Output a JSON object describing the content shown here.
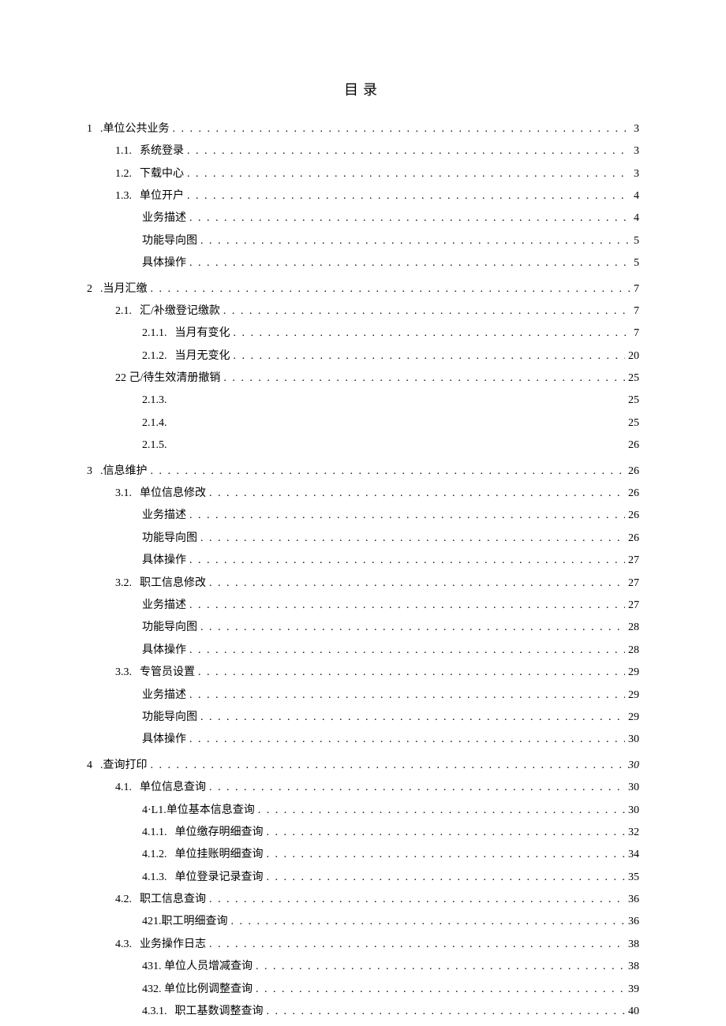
{
  "title": "目录",
  "entries": [
    {
      "indent": 0,
      "num": "1",
      "label": ".单位公共业务",
      "page": "3",
      "dots": true,
      "gap": false
    },
    {
      "indent": 1,
      "num": "1.1.",
      "label": "系统登录",
      "page": "3",
      "dots": true,
      "gap": false
    },
    {
      "indent": 1,
      "num": "1.2.",
      "label": "下载中心",
      "page": "3",
      "dots": true,
      "gap": false
    },
    {
      "indent": 1,
      "num": "1.3.",
      "label": "单位开户",
      "page": "4",
      "dots": true,
      "gap": false
    },
    {
      "indent": 2,
      "num": "",
      "label": "业务描述",
      "page": "4",
      "dots": true,
      "gap": false
    },
    {
      "indent": 2,
      "num": "",
      "label": "功能导向图",
      "page": "5",
      "dots": true,
      "gap": false
    },
    {
      "indent": 2,
      "num": "",
      "label": "具体操作",
      "page": "5",
      "dots": true,
      "gap": false
    },
    {
      "indent": 0,
      "num": "2",
      "label": ".当月汇缴",
      "page": "7",
      "dots": true,
      "gap": true
    },
    {
      "indent": 1,
      "num": "2.1.",
      "label": "汇/补缴登记缴款",
      "page": "7",
      "dots": true,
      "gap": false
    },
    {
      "indent": 2,
      "num": "2.1.1.",
      "label": "当月有变化",
      "page": "7",
      "dots": true,
      "gap": false
    },
    {
      "indent": 2,
      "num": "2.1.2.",
      "label": "当月无变化",
      "page": "20",
      "dots": true,
      "gap": false
    },
    {
      "indent": 1,
      "num": "",
      "label": "22 己/待生效清册撤销",
      "page": "25",
      "dots": true,
      "gap": false
    },
    {
      "indent": 2,
      "num": "2.1.3.",
      "label": "",
      "page": "25",
      "dots": false,
      "gap": false
    },
    {
      "indent": 2,
      "num": "2.1.4.",
      "label": "",
      "page": "25",
      "dots": false,
      "gap": false
    },
    {
      "indent": 2,
      "num": "2.1.5.",
      "label": "",
      "page": "26",
      "dots": false,
      "gap": false
    },
    {
      "indent": 0,
      "num": "3",
      "label": ".信息维护",
      "page": "26",
      "dots": true,
      "gap": true
    },
    {
      "indent": 1,
      "num": "3.1.",
      "label": "单位信息修改",
      "page": "26",
      "dots": true,
      "gap": false
    },
    {
      "indent": 2,
      "num": "",
      "label": "业务描述",
      "page": "26",
      "dots": true,
      "gap": false
    },
    {
      "indent": 2,
      "num": "",
      "label": "功能导向图",
      "page": "26",
      "dots": true,
      "gap": false
    },
    {
      "indent": 2,
      "num": "",
      "label": "具体操作",
      "page": "27",
      "dots": true,
      "gap": false
    },
    {
      "indent": 1,
      "num": "3.2.",
      "label": "职工信息修改",
      "page": "27",
      "dots": true,
      "gap": false
    },
    {
      "indent": 2,
      "num": "",
      "label": "业务描述",
      "page": "27",
      "dots": true,
      "gap": false
    },
    {
      "indent": 2,
      "num": "",
      "label": "功能导向图",
      "page": "28",
      "dots": true,
      "gap": false
    },
    {
      "indent": 2,
      "num": "",
      "label": "具体操作",
      "page": "28",
      "dots": true,
      "gap": false
    },
    {
      "indent": 1,
      "num": "3.3.",
      "label": "专管员设置",
      "page": "29",
      "dots": true,
      "gap": false
    },
    {
      "indent": 2,
      "num": "",
      "label": "业务描述",
      "page": "29",
      "dots": true,
      "gap": false
    },
    {
      "indent": 2,
      "num": "",
      "label": "功能导向图",
      "page": "29",
      "dots": true,
      "gap": false
    },
    {
      "indent": 2,
      "num": "",
      "label": "具体操作",
      "page": "30",
      "dots": true,
      "gap": false
    },
    {
      "indent": 0,
      "num": "4",
      "label": ".查询打印",
      "page": "30",
      "dots": true,
      "gap": true,
      "italicPage": true
    },
    {
      "indent": 1,
      "num": "4.1.",
      "label": "单位信息查询",
      "page": "30",
      "dots": true,
      "gap": false
    },
    {
      "indent": 2,
      "num": "",
      "label": "4·L1.单位基本信息查询",
      "page": "30",
      "dots": true,
      "gap": false
    },
    {
      "indent": 2,
      "num": "4.1.1.",
      "label": "单位缴存明细查询",
      "page": "32",
      "dots": true,
      "gap": false
    },
    {
      "indent": 2,
      "num": "4.1.2.",
      "label": "单位挂账明细查询",
      "page": "34",
      "dots": true,
      "gap": false
    },
    {
      "indent": 2,
      "num": "4.1.3.",
      "label": "单位登录记录查询",
      "page": "35",
      "dots": true,
      "gap": false
    },
    {
      "indent": 1,
      "num": "4.2.",
      "label": "职工信息查询",
      "page": "36",
      "dots": true,
      "gap": false
    },
    {
      "indent": 2,
      "num": "",
      "label": "421.职工明细查询",
      "page": "36",
      "dots": true,
      "gap": false
    },
    {
      "indent": 1,
      "num": "4.3.",
      "label": "业务操作日志",
      "page": "38",
      "dots": true,
      "gap": false
    },
    {
      "indent": 2,
      "num": "",
      "label": "431. 单位人员增减查询",
      "page": "38",
      "dots": true,
      "gap": false
    },
    {
      "indent": 2,
      "num": "",
      "label": "432. 单位比例调整查询",
      "page": "39",
      "dots": true,
      "gap": false
    },
    {
      "indent": 2,
      "num": "4.3.1.",
      "label": "职工基数调整查询",
      "page": "40",
      "dots": true,
      "gap": false
    }
  ]
}
